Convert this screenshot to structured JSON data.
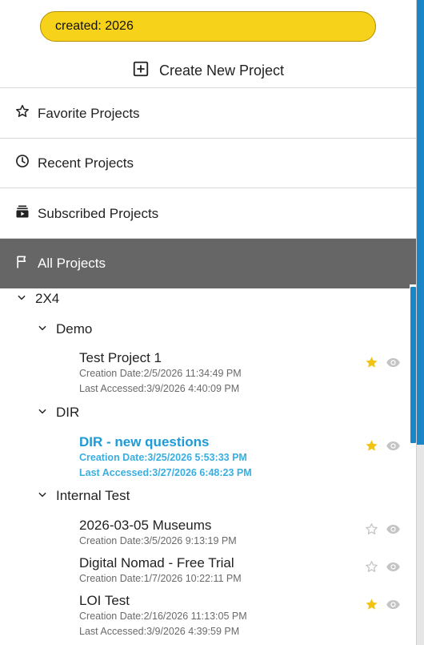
{
  "search": {
    "value": "created: 2026"
  },
  "create": {
    "label": "Create New Project"
  },
  "nav": [
    {
      "label": "Favorite Projects",
      "icon": "star-outline-icon"
    },
    {
      "label": "Recent Projects",
      "icon": "clock-icon"
    },
    {
      "label": "Subscribed Projects",
      "icon": "subscriptions-icon"
    },
    {
      "label": "All Projects",
      "icon": "flag-icon",
      "active": true
    }
  ],
  "tree": {
    "root": "2X4",
    "groups": [
      {
        "name": "Demo",
        "projects": [
          {
            "title": "Test Project 1",
            "created": "Creation Date:2/5/2026 11:34:49 PM",
            "accessed": "Last Accessed:3/9/2026 4:40:09 PM",
            "favorite": true
          }
        ]
      },
      {
        "name": "DIR",
        "projects": [
          {
            "title": "DIR - new questions",
            "created": "Creation Date:3/25/2026 5:53:33 PM",
            "accessed": "Last Accessed:3/27/2026 6:48:23 PM",
            "favorite": true,
            "highlighted": true
          }
        ]
      },
      {
        "name": "Internal Test",
        "projects": [
          {
            "title": "2026-03-05 Museums",
            "created": "Creation Date:3/5/2026 9:13:19 PM",
            "favorite": false
          },
          {
            "title": "Digital Nomad - Free Trial",
            "created": "Creation Date:1/7/2026 10:22:11 PM",
            "favorite": false
          },
          {
            "title": "LOI Test",
            "created": "Creation Date:2/16/2026 11:13:05 PM",
            "accessed": "Last Accessed:3/9/2026 4:39:59 PM",
            "favorite": true
          }
        ]
      }
    ]
  },
  "colors": {
    "search_bg": "#f7d21a",
    "active_nav": "#666666",
    "accent": "#1a86c8",
    "highlight_text": "#1e9ad6",
    "star_filled": "#f2c40f"
  }
}
